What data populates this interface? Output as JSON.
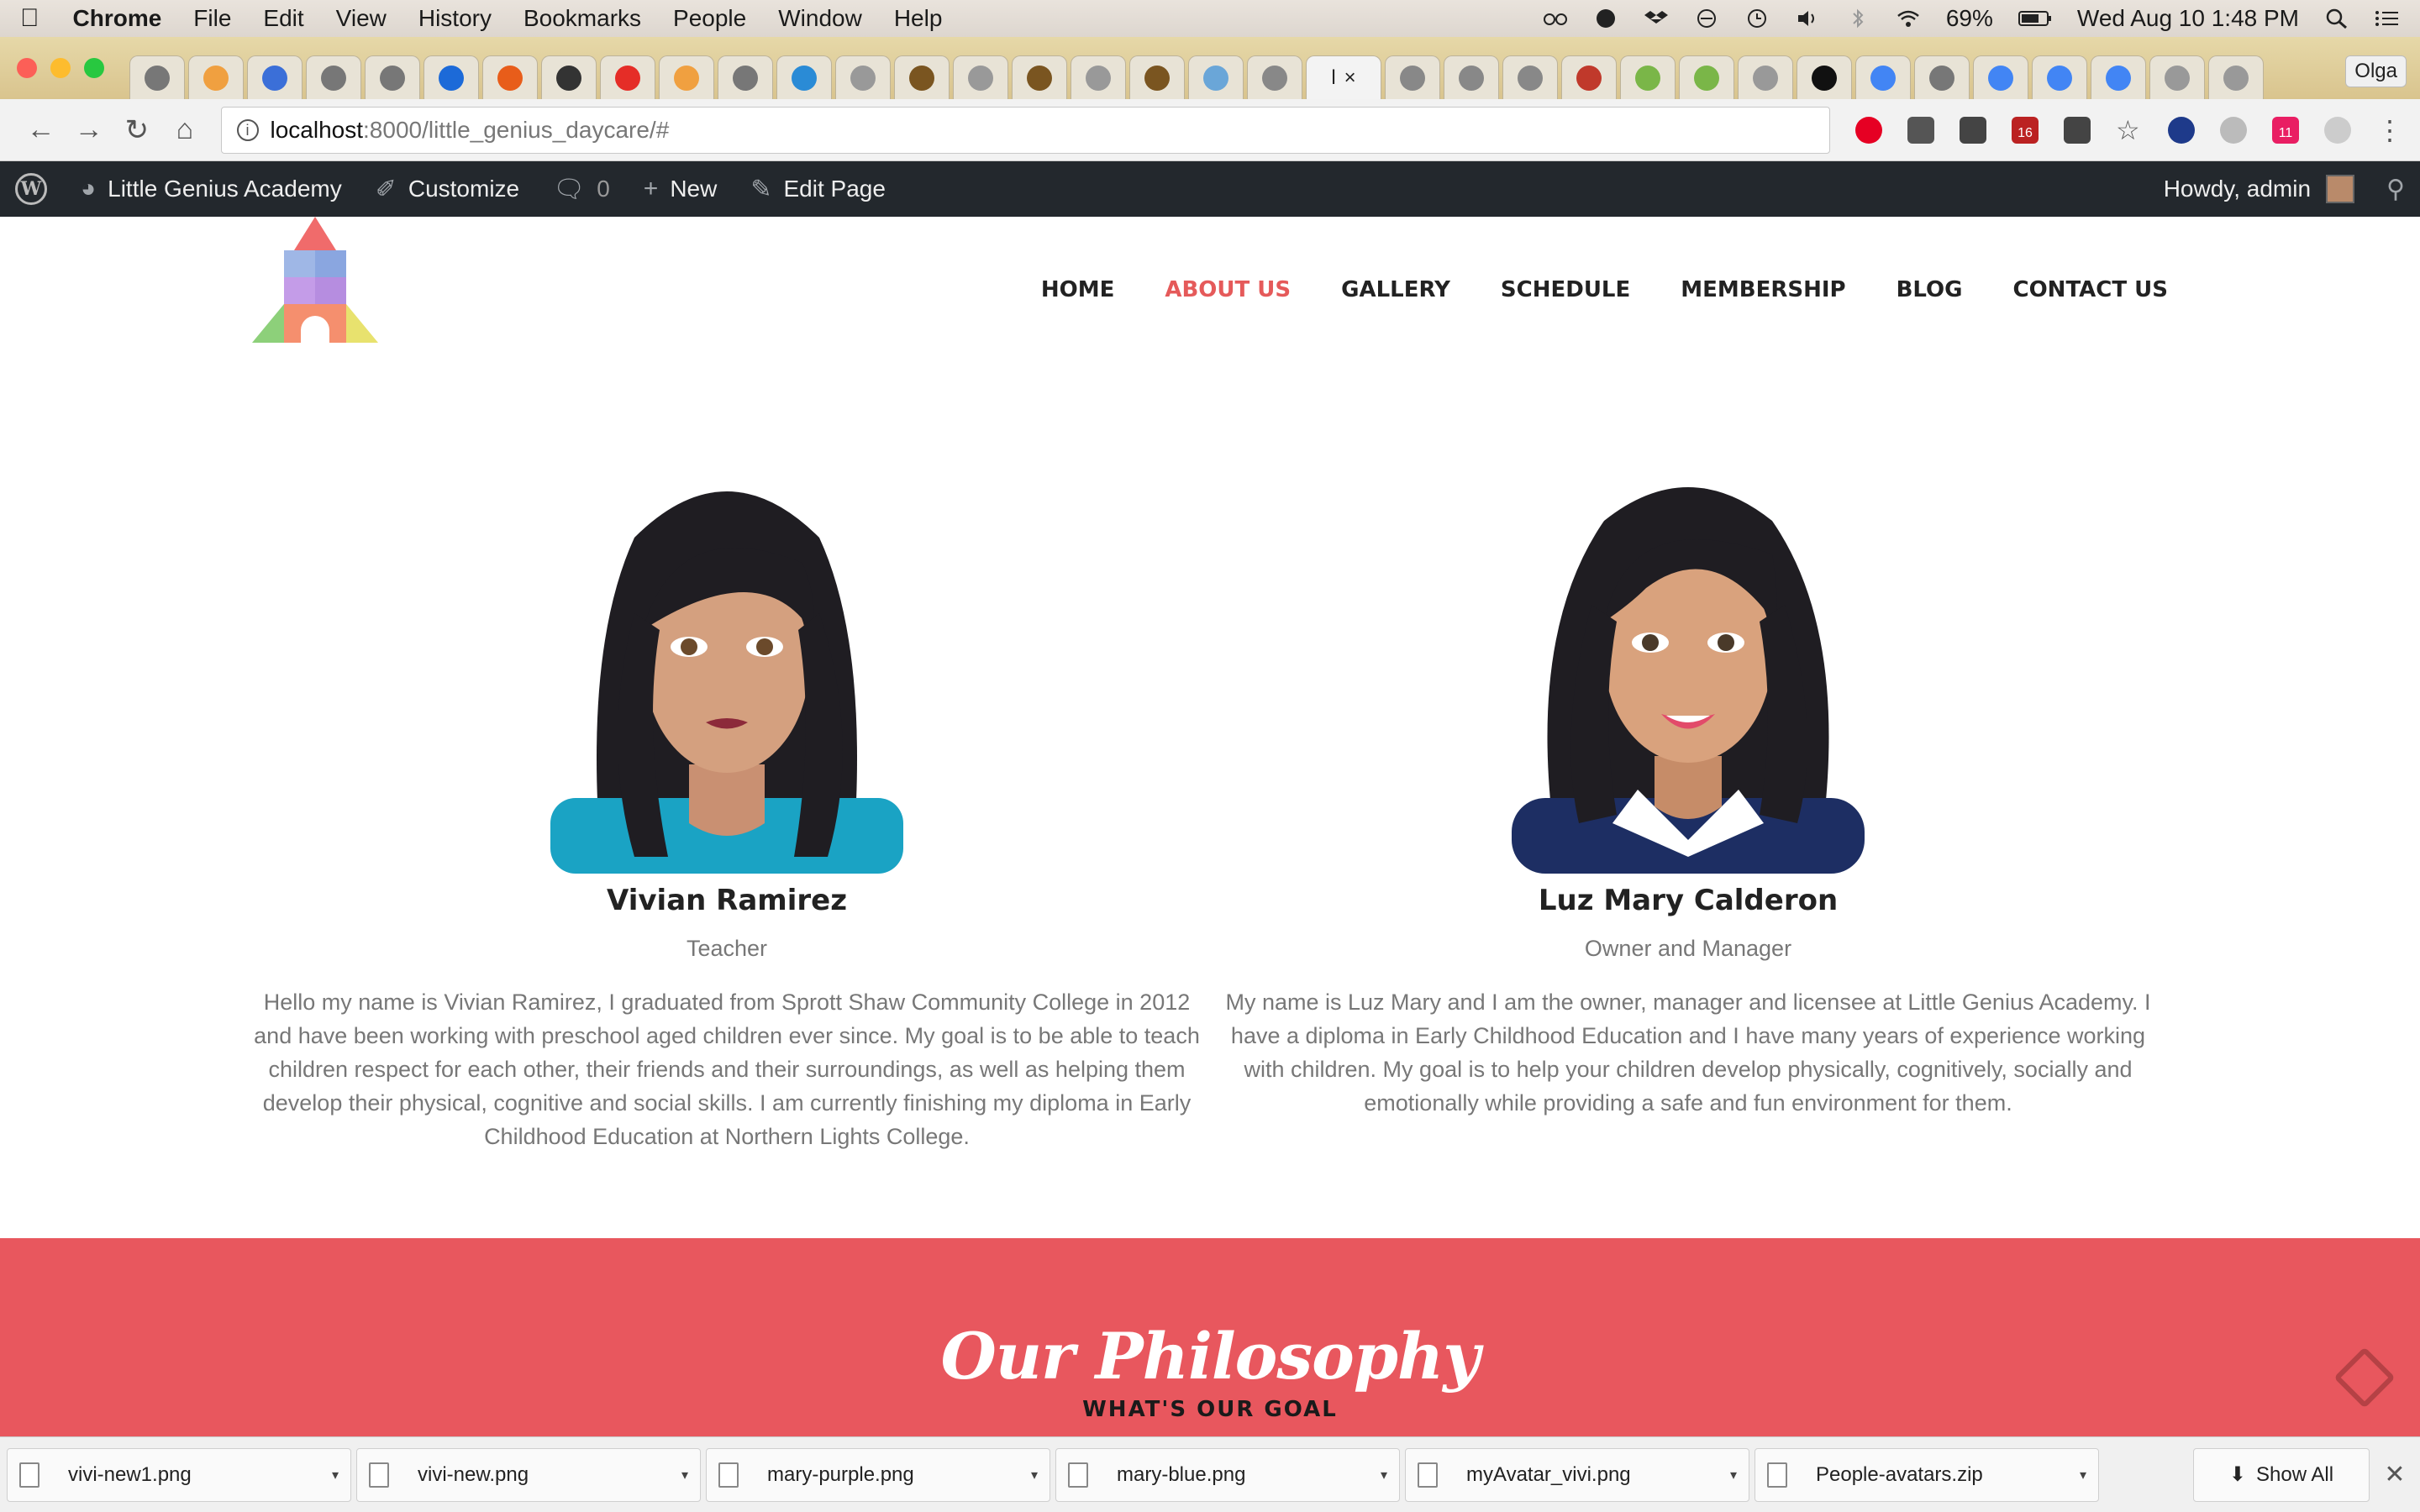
{
  "menubar": {
    "app": "Chrome",
    "items": [
      "File",
      "Edit",
      "View",
      "History",
      "Bookmarks",
      "People",
      "Window",
      "Help"
    ],
    "battery": "69%",
    "clock": "Wed Aug 10  1:48 PM"
  },
  "browser": {
    "profile": "Olga",
    "url_host": "localhost",
    "url_path": ":8000/little_genius_daycare/#",
    "active_tab_label": "l",
    "ext_badges": [
      "16",
      "11"
    ]
  },
  "adminbar": {
    "site": "Little Genius Academy",
    "customize": "Customize",
    "comments": "0",
    "new": "New",
    "edit": "Edit Page",
    "howdy": "Howdy, admin"
  },
  "nav": {
    "items": [
      "HOME",
      "ABOUT US",
      "GALLERY",
      "SCHEDULE",
      "MEMBERSHIP",
      "BLOG",
      "CONTACT US"
    ],
    "active": "ABOUT US"
  },
  "team": [
    {
      "name": "Vivian Ramirez",
      "role": "Teacher",
      "bio": "Hello my name is Vivian Ramirez, I graduated from Sprott Shaw Community College in 2012 and have been working with preschool aged children ever since. My goal is to be able to teach children respect for each other, their friends and their surroundings, as well as helping them develop their physical, cognitive and social skills. I am currently finishing my diploma in Early Childhood Education at Northern Lights College."
    },
    {
      "name": "Luz Mary Calderon",
      "role": "Owner and Manager",
      "bio": "My name is Luz Mary and I am the owner, manager and licensee at Little Genius Academy. I have a diploma in Early Childhood Education and I have many years of experience working with children. My goal is to help your children develop physically, cognitively, socially and emotionally while providing a safe and fun environment for them."
    }
  ],
  "philosophy": {
    "title": "Our Philosophy",
    "subtitle": "WHAT'S OUR GOAL"
  },
  "downloads": {
    "files": [
      "vivi-new1.png",
      "vivi-new.png",
      "mary-purple.png",
      "mary-blue.png",
      "myAvatar_vivi.png",
      "People-avatars.zip"
    ],
    "show_all": "Show All"
  },
  "colors": {
    "accent": "#e8575e",
    "nav_active": "#e55a5a",
    "adminbar": "#23282d"
  }
}
